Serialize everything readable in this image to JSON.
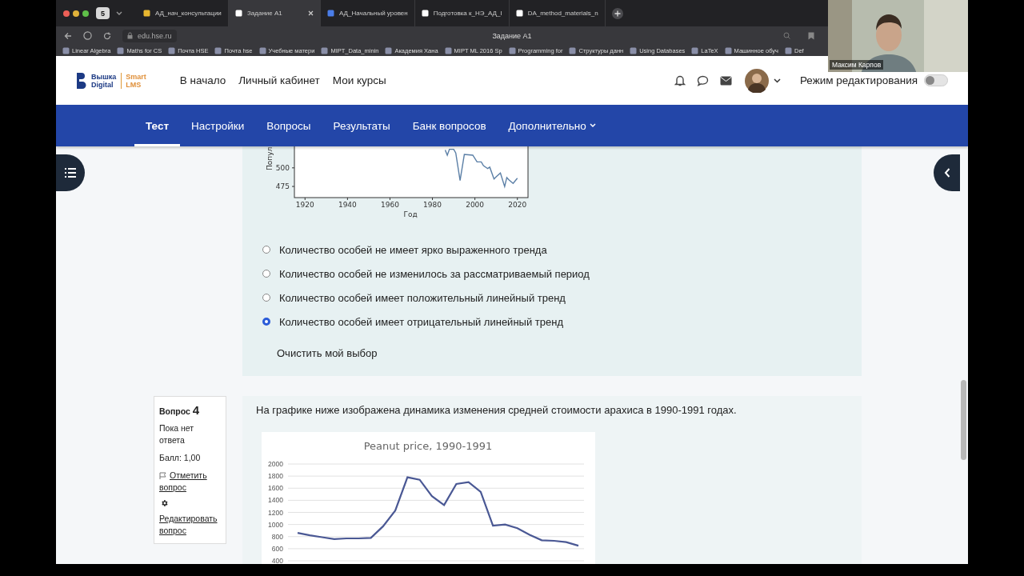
{
  "browser": {
    "tab_count": "5",
    "tabs": [
      {
        "title": "АД_нач_консультации",
        "kind": "doc",
        "selected": false
      },
      {
        "title": "Задание A1",
        "kind": "hse",
        "selected": true
      },
      {
        "title": "АД_Начальный уровен",
        "kind": "gdoc",
        "selected": false
      },
      {
        "title": "Подготовка к_НЭ_АД_I",
        "kind": "hse",
        "selected": false
      },
      {
        "title": "DA_method_materials_n",
        "kind": "hse",
        "selected": false
      }
    ],
    "address": "edu.hse.ru",
    "page_title": "Задание A1",
    "bookmarks": [
      "Linear Algebra",
      "Maths for CS",
      "Почта HSE",
      "Почта hse",
      "Учебные матери",
      "MIPT_Data_minin",
      "Академия Хана",
      "MIPT ML 2016 Sp",
      "Programming for",
      "Структуры данн",
      "Using Databases",
      "LaTeX",
      "Машинное обуч",
      "Def"
    ]
  },
  "webcam": {
    "name": "Максим Карпов"
  },
  "header": {
    "logo": {
      "line1": "Вышка",
      "line2": "Digital",
      "product1": "Smart",
      "product2": "LMS"
    },
    "links": [
      "В начало",
      "Личный кабинет",
      "Мои курсы"
    ],
    "edit_mode": {
      "label": "Режим редактирования",
      "on": false
    }
  },
  "nav": [
    {
      "label": "Тест",
      "selected": true,
      "dropdown": false
    },
    {
      "label": "Настройки",
      "selected": false,
      "dropdown": false
    },
    {
      "label": "Вопросы",
      "selected": false,
      "dropdown": false
    },
    {
      "label": "Результаты",
      "selected": false,
      "dropdown": false
    },
    {
      "label": "Банк вопросов",
      "selected": false,
      "dropdown": false
    },
    {
      "label": "Дополнительно",
      "selected": false,
      "dropdown": true
    }
  ],
  "question3": {
    "chart_data": {
      "type": "line",
      "xlabel": "Год",
      "ylabel": "Попул",
      "xlim": [
        1915,
        2025
      ],
      "ylim": [
        460,
        531
      ],
      "xticks": [
        1920,
        1940,
        1960,
        1980,
        2000,
        2020
      ],
      "yticks": [
        475,
        500
      ],
      "x": [
        1986,
        1987,
        1988,
        1990,
        1991,
        1993,
        1995,
        1999,
        2001,
        2003,
        2004,
        2006,
        2007,
        2009,
        2010,
        2012,
        2014,
        2015,
        2016,
        2018,
        2020
      ],
      "series": [
        {
          "color": "#5b7fa6",
          "values": [
            524,
            517,
            525,
            525,
            520,
            483,
            518,
            517,
            508,
            508,
            503,
            499,
            501,
            485,
            488,
            493,
            475,
            487,
            484,
            479,
            486
          ]
        }
      ]
    },
    "options": [
      {
        "text": "Количество особей не имеет ярко выраженного тренда",
        "selected": false
      },
      {
        "text": "Количество особей не изменилось за рассматриваемый период",
        "selected": false
      },
      {
        "text": "Количество особей имеет положительный линейный тренд",
        "selected": false
      },
      {
        "text": "Количество особей имеет отрицательный линейный тренд",
        "selected": true
      }
    ],
    "clear": "Очистить мой выбор"
  },
  "question4": {
    "label": "Вопрос",
    "number": "4",
    "status": "Пока нет ответа",
    "score": "Балл: 1,00",
    "flag": "Отметить вопрос",
    "edit": "Редактировать вопрос",
    "text": "На графике ниже изображена динамика изменения средней стоимости арахиса в 1990-1991 годах.",
    "chart_data": {
      "type": "line",
      "title": "Peanut price, 1990-1991",
      "grid": true,
      "ylim": [
        400,
        2000
      ],
      "yticks": [
        400,
        600,
        800,
        1000,
        1200,
        1400,
        1600,
        1800,
        2000
      ],
      "series": [
        {
          "color": "#4a5894",
          "values": [
            860,
            820,
            790,
            760,
            770,
            770,
            780,
            970,
            1230,
            1780,
            1740,
            1470,
            1320,
            1670,
            1700,
            1540,
            980,
            1000,
            940,
            830,
            740,
            730,
            710,
            650
          ]
        }
      ]
    }
  }
}
